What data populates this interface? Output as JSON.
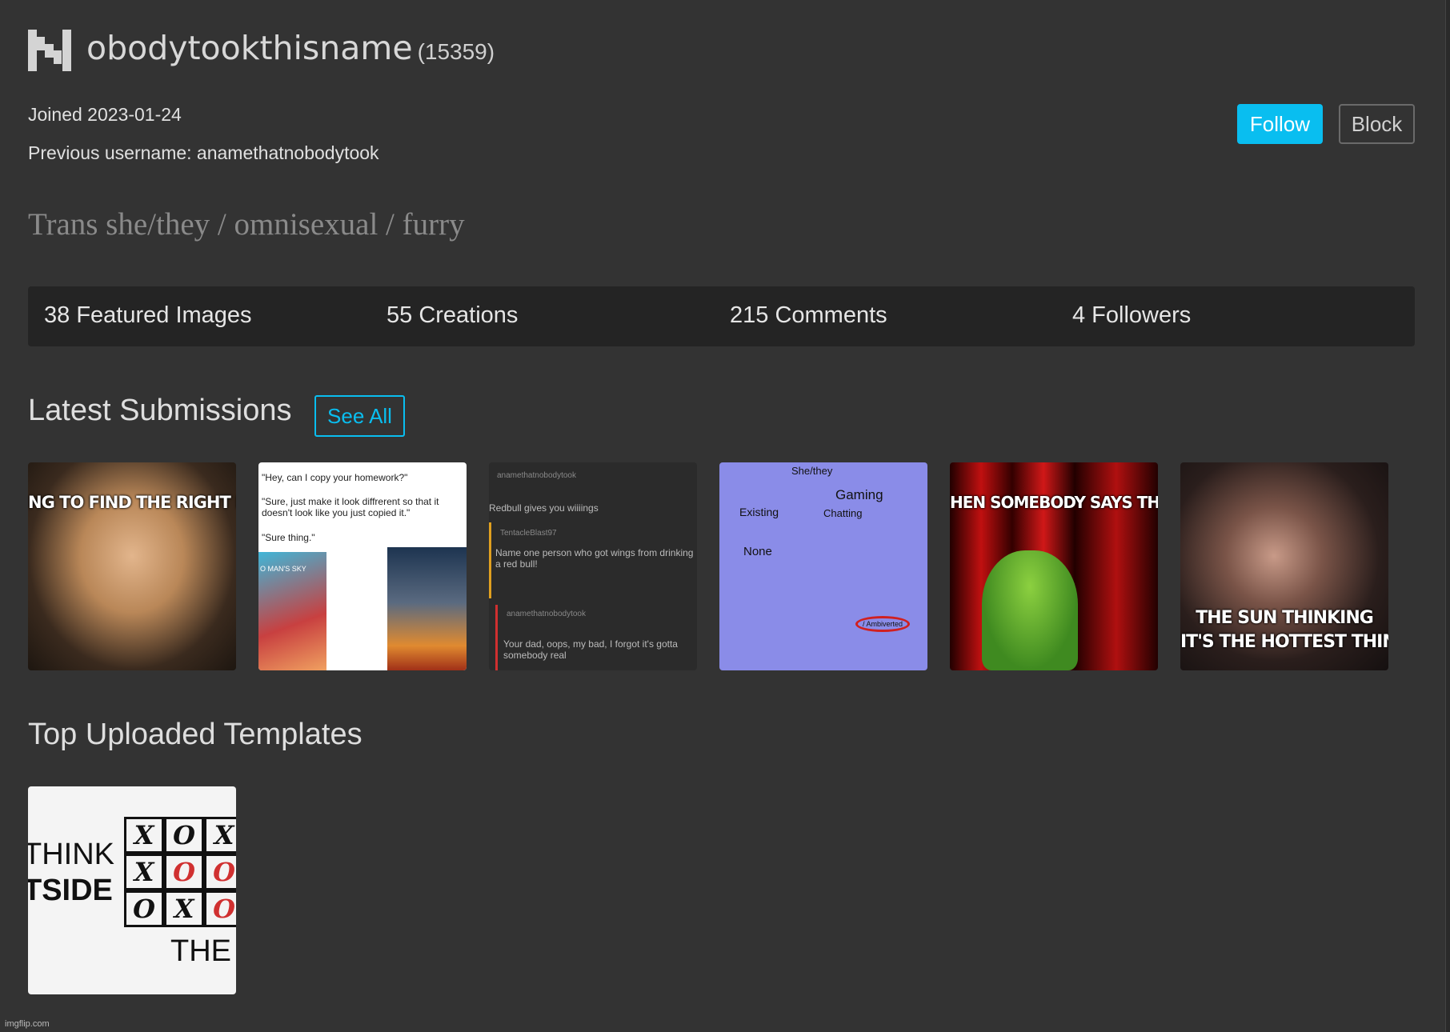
{
  "profile": {
    "logo_letter": "N",
    "username": "obodytookthisname",
    "points": "(15359)",
    "joined": "Joined 2023-01-24",
    "previous_username": "Previous username: anamethatnobodytook",
    "bio": "Trans she/they / omnisexual / furry"
  },
  "actions": {
    "follow": "Follow",
    "block": "Block",
    "follow_color": "#09bef0"
  },
  "stats": [
    "38 Featured Images",
    "55 Creations",
    "215 Comments",
    "4 Followers"
  ],
  "latest": {
    "heading": "Latest Submissions",
    "see_all": "See All",
    "items": [
      {
        "caption": "NG TO FIND THE RIGHT MEME TE",
        "icon": "meme-thumbnail"
      },
      {
        "lines": [
          "\"Hey, can I copy  your homework?\"",
          "\"Sure, just make it look diffrerent so that it doesn't look like you just copied it.\"",
          "\"Sure thing.\""
        ],
        "sub": "O MAN'S SKY",
        "icon": "meme-thumbnail"
      },
      {
        "lines": [
          "anamethatnobodytook",
          "Redbull gives you wiiiings",
          "TentacleBlast97",
          "Name one person who got wings from drinking a red bull!",
          "anamethatnobodytook",
          "Your dad, oops, my bad, I forgot it's gotta somebody real"
        ],
        "icon": "meme-thumbnail"
      },
      {
        "lines": [
          "She/they",
          "Gaming",
          "Existing",
          "Chatting",
          "None",
          "/ Ambiverted"
        ],
        "icon": "meme-thumbnail"
      },
      {
        "caption": "HEN SOMEBODY SAYS THEIR \"C",
        "icon": "meme-thumbnail"
      },
      {
        "caption": "THE SUN THINKING",
        "caption2": "IT'S THE HOTTEST THIN",
        "icon": "meme-thumbnail"
      }
    ]
  },
  "templates": {
    "heading": "Top Uploaded Templates",
    "items": [
      {
        "lines": [
          "THINK",
          "TSIDE",
          "THE"
        ],
        "grid": [
          "X",
          "O",
          "X",
          "X",
          "O",
          "O",
          "O",
          "X",
          "O"
        ],
        "icon": "template-thumbnail"
      }
    ]
  },
  "footer": {
    "watermark": "imgflip.com"
  }
}
